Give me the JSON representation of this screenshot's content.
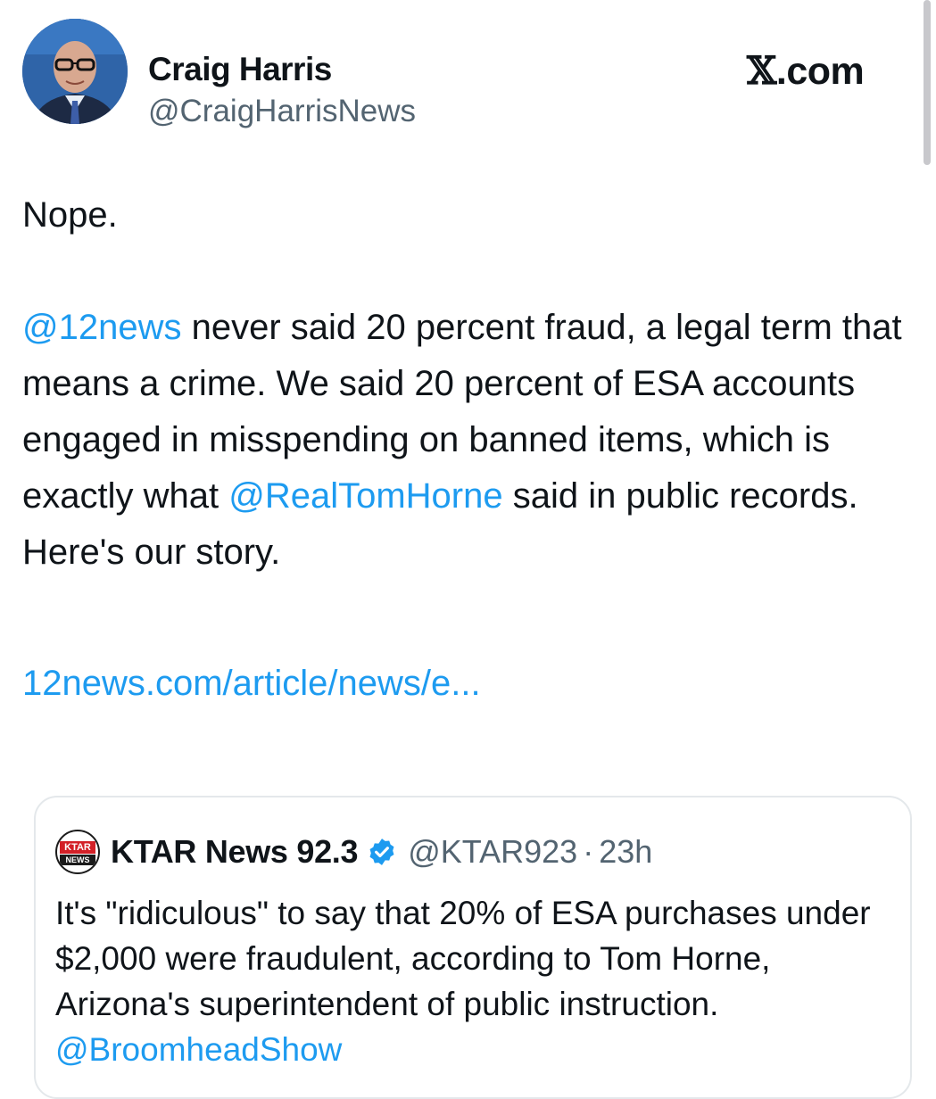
{
  "author": {
    "name": "Craig Harris",
    "handle": "@CraigHarrisNews"
  },
  "brand": {
    "prefix": "𝕏",
    "suffix": ".com"
  },
  "tweet": {
    "line1": "Nope.",
    "mention1": "@12news",
    "text_a": " never said 20 percent fraud, a legal term that means a crime. We said 20 percent of ESA accounts engaged in misspending on banned items, which is exactly what ",
    "mention2": "@RealTomHorne",
    "text_b": " said in public records. Here's our story.",
    "link": "12news.com/article/news/e..."
  },
  "quote": {
    "avatar_top": "KTAR",
    "avatar_bottom": "NEWS",
    "name": "KTAR News 92.3",
    "handle": "@KTAR923",
    "separator": "·",
    "time": "23h",
    "text": "It's \"ridiculous\" to say that 20% of ESA purchases under $2,000 were fraudulent, according to Tom Horne, Arizona's superintendent of public instruction. ",
    "mention": "@BroomheadShow"
  },
  "colors": {
    "link": "#1d9bf0",
    "secondary_text": "#536471",
    "verified": "#1d9bf0"
  }
}
